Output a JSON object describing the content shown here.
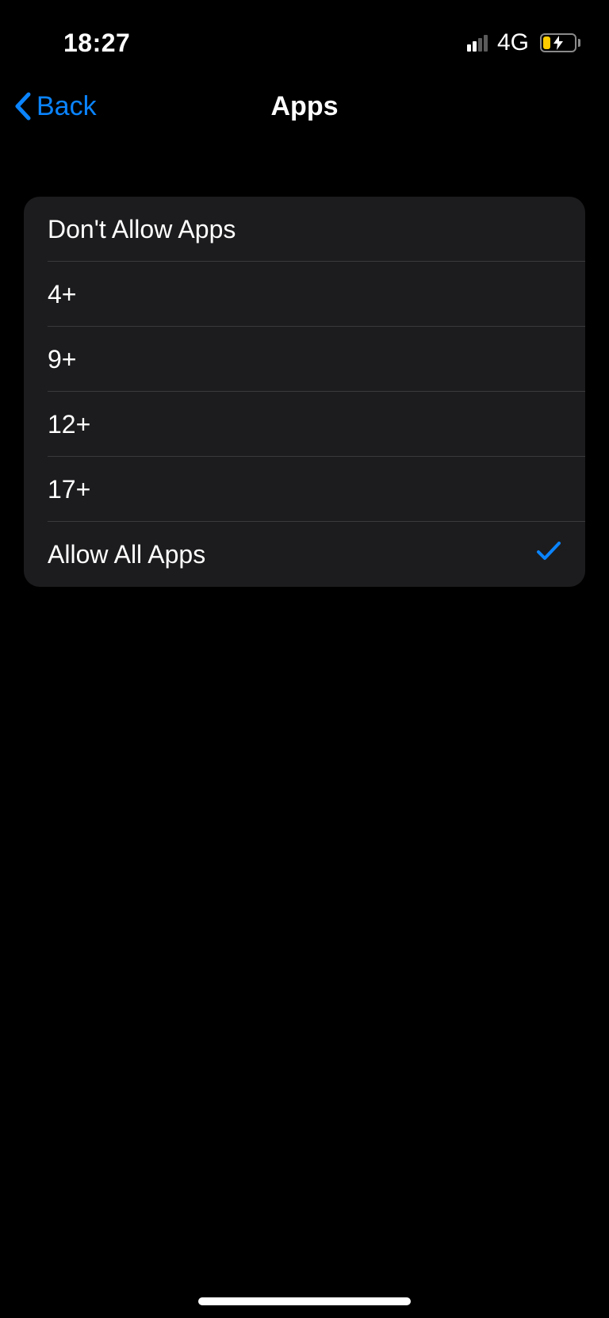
{
  "statusBar": {
    "time": "18:27",
    "network": "4G"
  },
  "nav": {
    "backLabel": "Back",
    "title": "Apps"
  },
  "options": [
    {
      "label": "Don't Allow Apps",
      "selected": false
    },
    {
      "label": "4+",
      "selected": false
    },
    {
      "label": "9+",
      "selected": false
    },
    {
      "label": "12+",
      "selected": false
    },
    {
      "label": "17+",
      "selected": false
    },
    {
      "label": "Allow All Apps",
      "selected": true
    }
  ]
}
